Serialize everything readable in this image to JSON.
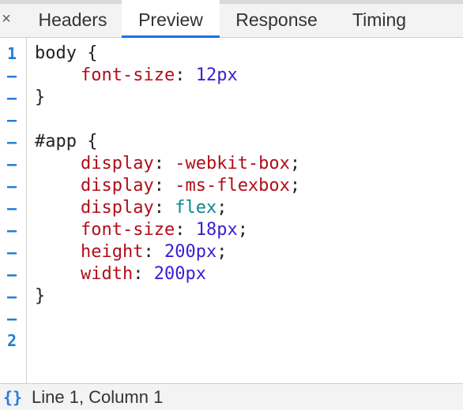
{
  "tabs": {
    "close": "×",
    "headers": "Headers",
    "preview": "Preview",
    "response": "Response",
    "timing": "Timing"
  },
  "gutter": [
    "1",
    "–",
    "–",
    "–",
    "–",
    "–",
    "–",
    "–",
    "–",
    "–",
    "–",
    "–",
    "–",
    "2"
  ],
  "code": {
    "l1_sel": "body",
    "l1_brace": " {",
    "l2_prop": "font-size",
    "l2_colon": ": ",
    "l2_val": "12px",
    "l3": "}",
    "l5_sel": "#app",
    "l5_brace": " {",
    "l6_prop": "display",
    "l6_colon": ": ",
    "l6_val": "-webkit-box",
    "l6_end": ";",
    "l7_prop": "display",
    "l7_colon": ": ",
    "l7_val": "-ms-flexbox",
    "l7_end": ";",
    "l8_prop": "display",
    "l8_colon": ": ",
    "l8_val": "flex",
    "l8_end": ";",
    "l9_prop": "font-size",
    "l9_colon": ": ",
    "l9_val": "18px",
    "l9_end": ";",
    "l10_prop": "height",
    "l10_colon": ": ",
    "l10_val": "200px",
    "l10_end": ";",
    "l11_prop": "width",
    "l11_colon": ": ",
    "l11_val": "200px",
    "l12": "}"
  },
  "status": {
    "icon": "{}",
    "text": "Line 1, Column 1"
  },
  "colors": {
    "property": "#b10d19",
    "number": "#3a1ed2",
    "keyword": "#0b8a8a",
    "accent": "#1a73e8"
  }
}
